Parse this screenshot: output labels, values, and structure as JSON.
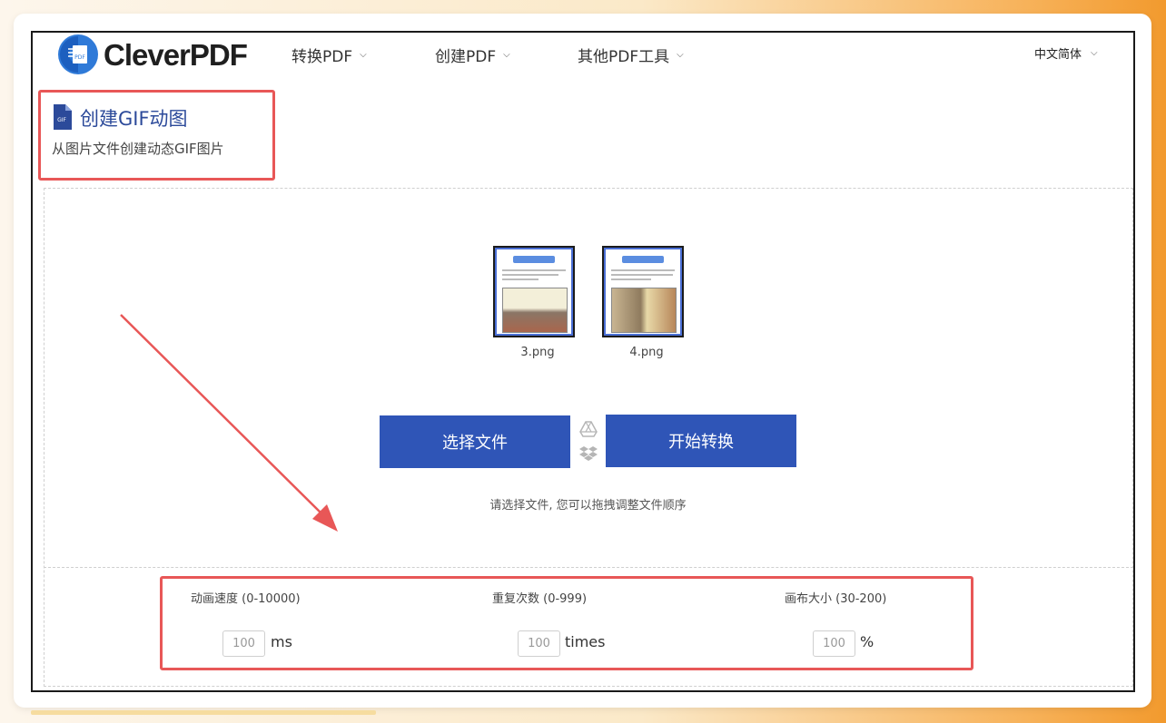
{
  "header": {
    "brand": "CleverPDF",
    "logo_icon": "cleverpdf-logo-icon",
    "nav": [
      {
        "label": "转换PDF"
      },
      {
        "label": "创建PDF"
      },
      {
        "label": "其他PDF工具"
      }
    ],
    "language": "中文简体"
  },
  "tool": {
    "title": "创建GIF动图",
    "subtitle": "从图片文件创建动态GIF图片",
    "icon": "gif-file-icon"
  },
  "files": [
    {
      "name": "3.png"
    },
    {
      "name": "4.png"
    }
  ],
  "actions": {
    "choose_label": "选择文件",
    "start_label": "开始转换",
    "cloud_icons": [
      "google-drive-icon",
      "dropbox-icon"
    ],
    "hint": "请选择文件, 您可以拖拽调整文件顺序"
  },
  "options": {
    "speed": {
      "label": "动画速度 (0-10000)",
      "value": "100",
      "unit": "ms"
    },
    "repeat": {
      "label": "重复次数 (0-999)",
      "value": "100",
      "unit": "times"
    },
    "canvas": {
      "label": "画布大小 (30-200)",
      "value": "100",
      "unit": "%"
    }
  },
  "colors": {
    "accent": "#2f55b7",
    "title": "#2c4a9a",
    "highlight": "#e85757"
  }
}
